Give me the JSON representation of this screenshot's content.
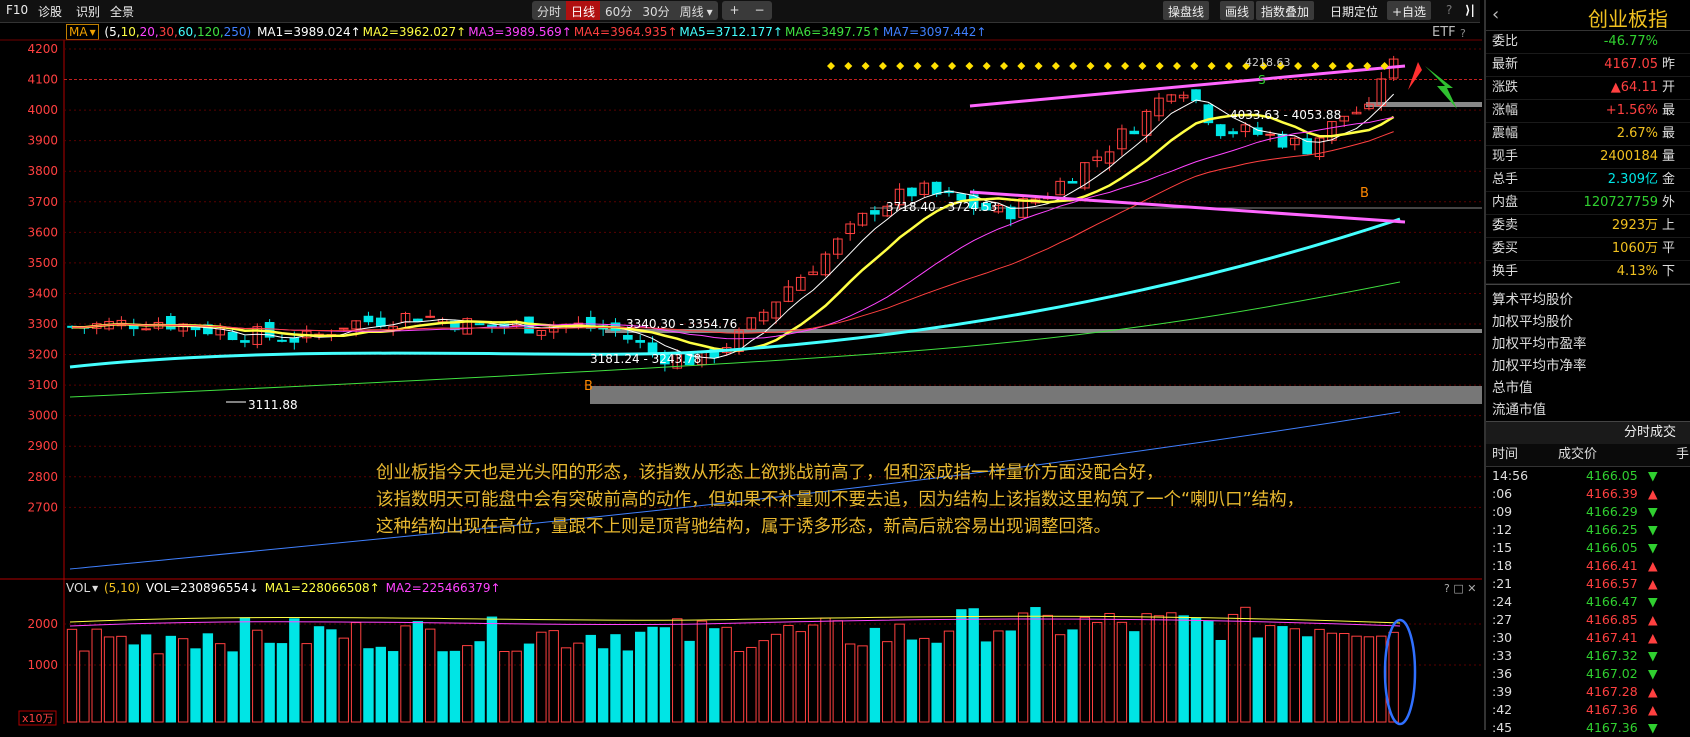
{
  "toolbar": {
    "f10": "F10",
    "diagnose": "诊股",
    "recognize": "识别",
    "fullview": "全景",
    "periods": [
      "分时",
      "日线",
      "60分",
      "30分",
      "周线"
    ],
    "active_period": "日线",
    "weekly_arrow": "▾",
    "plus": "+",
    "minus": "−",
    "right_buttons": [
      "操盘线",
      "画线",
      "指数叠加",
      "日期定位",
      "+自选"
    ],
    "help": "?",
    "etf": "ETF",
    "help2": "?",
    "collapse": "▾"
  },
  "ma_legend": {
    "tag": "MA",
    "params": "(5,10,20,30,60,120,250)",
    "params_parts": [
      {
        "t": "(5,",
        "c": "#ffffff"
      },
      {
        "t": "10,",
        "c": "#ffff44"
      },
      {
        "t": "20,",
        "c": "#ff44ff"
      },
      {
        "t": "30,",
        "c": "#ff4040"
      },
      {
        "t": "60,",
        "c": "#44ffff"
      },
      {
        "t": "120,",
        "c": "#40e040"
      },
      {
        "t": "250)",
        "c": "#4080ff"
      }
    ],
    "items": [
      {
        "text": "MA1=3989.024↑",
        "color": "#ffffff"
      },
      {
        "text": "MA2=3962.027↑",
        "color": "#ffff44"
      },
      {
        "text": "MA3=3989.569↑",
        "color": "#ff44ff"
      },
      {
        "text": "MA4=3964.935↑",
        "color": "#ff4040"
      },
      {
        "text": "MA5=3712.177↑",
        "color": "#44ffff"
      },
      {
        "text": "MA6=3497.75↑",
        "color": "#40e040"
      },
      {
        "text": "MA7=3097.442↑",
        "color": "#4080ff"
      }
    ]
  },
  "y_axis_labels": [
    "4200",
    "4100",
    "4000",
    "3900",
    "3800",
    "3700",
    "3600",
    "3500",
    "3400",
    "3300",
    "3200",
    "3100",
    "3000",
    "2900",
    "2800",
    "2700"
  ],
  "price_annotations": {
    "high1": "4033.63 - 4053.88",
    "mid1": "3718.40 - 3724.53",
    "mid2": "3340.30 - 3354.76",
    "low1": "3181.24 - 3243.78",
    "low_point": "3111.88",
    "top_label": "4218.63",
    "b1": "B",
    "b2": "B",
    "s1": "S"
  },
  "analysis_text": [
    "创业板指今天也是光头阳的形态，该指数从形态上欲挑战前高了，但和深成指一样量价方面没配合好，",
    "该指数明天可能盘中会有突破前高的动作，但如果不补量则不要去追，因为结构上该指数这里构筑了一个“喇叭口”结构，",
    "这种结构出现在高位，量跟不上则是顶背驰结构，属于诱多形态，新高后就容易出现调整回落。"
  ],
  "vol_legend": {
    "tag": "VOL",
    "params": "(5,10)",
    "vol": "VOL=230896554↓",
    "ma1": "MA1=228066508↑",
    "ma2": "MA2=225466379↑",
    "icons": "? □ ✕"
  },
  "vol_axis_labels": [
    "2000",
    "1000"
  ],
  "vol_unit": "x10万",
  "right_panel": {
    "back": "‹",
    "name": "创业板指",
    "rows": [
      {
        "k": "委比",
        "v": "-46.77%",
        "vc": "#30d030",
        "k2": ""
      },
      {
        "k": "最新",
        "v": "4167.05",
        "vc": "#ff4040",
        "k2": "昨"
      },
      {
        "k": "涨跌",
        "v": "▲64.11",
        "vc": "#ff4040",
        "k2": "开"
      },
      {
        "k": "涨幅",
        "v": "+1.56%",
        "vc": "#ff4040",
        "k2": "最"
      },
      {
        "k": "震幅",
        "v": "2.67%",
        "vc": "#f0c020",
        "k2": "最"
      },
      {
        "k": "现手",
        "v": "2400184",
        "vc": "#f0c020",
        "k2": "量"
      },
      {
        "k": "总手",
        "v": "2.309亿",
        "vc": "#00e5e5",
        "k2": "金"
      },
      {
        "k": "内盘",
        "v": "120727759",
        "vc": "#30d030",
        "k2": "外"
      },
      {
        "k": "委卖",
        "v": "2923万",
        "vc": "#f0c020",
        "k2": "上"
      },
      {
        "k": "委买",
        "v": "1060万",
        "vc": "#f0c020",
        "k2": "平"
      },
      {
        "k": "换手",
        "v": "4.13%",
        "vc": "#f0c020",
        "k2": "下"
      }
    ],
    "stats": [
      "算术平均股价",
      "加权平均股价",
      "加权平均市盈率",
      "加权平均市净率",
      "总市值",
      "流通市值"
    ],
    "ticks_title": "分时成交",
    "ticks_head": {
      "time": "时间",
      "price": "成交价",
      "vol": "手"
    },
    "ticks": [
      {
        "t": "14:56",
        "p": "4166.05",
        "d": "▼",
        "c": "#30d030"
      },
      {
        "t": ":06",
        "p": "4166.39",
        "d": "▲",
        "c": "#ff4040"
      },
      {
        "t": ":09",
        "p": "4166.29",
        "d": "▼",
        "c": "#30d030"
      },
      {
        "t": ":12",
        "p": "4166.25",
        "d": "▼",
        "c": "#30d030"
      },
      {
        "t": ":15",
        "p": "4166.05",
        "d": "▼",
        "c": "#30d030"
      },
      {
        "t": ":18",
        "p": "4166.41",
        "d": "▲",
        "c": "#ff4040"
      },
      {
        "t": ":21",
        "p": "4166.57",
        "d": "▲",
        "c": "#ff4040"
      },
      {
        "t": ":24",
        "p": "4166.47",
        "d": "▼",
        "c": "#30d030"
      },
      {
        "t": ":27",
        "p": "4166.85",
        "d": "▲",
        "c": "#ff4040"
      },
      {
        "t": ":30",
        "p": "4167.41",
        "d": "▲",
        "c": "#ff4040"
      },
      {
        "t": ":33",
        "p": "4167.32",
        "d": "▼",
        "c": "#30d030"
      },
      {
        "t": ":36",
        "p": "4167.02",
        "d": "▼",
        "c": "#30d030"
      },
      {
        "t": ":39",
        "p": "4167.28",
        "d": "▲",
        "c": "#ff4040"
      },
      {
        "t": ":42",
        "p": "4167.36",
        "d": "▲",
        "c": "#ff4040"
      },
      {
        "t": ":45",
        "p": "4167.36",
        "d": "▼",
        "c": "#30d030"
      }
    ]
  },
  "colors": {
    "up": "#ff4040",
    "down": "#00e5e5",
    "grid": "#5a0000",
    "axis": "#b00000"
  }
}
